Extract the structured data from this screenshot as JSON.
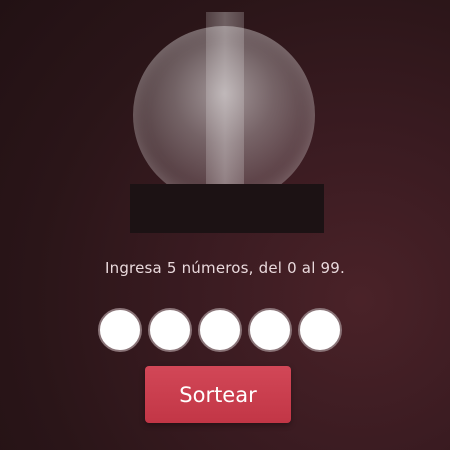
{
  "instruction": "Ingresa 5 números, del 0 al 99.",
  "number_inputs": [
    {
      "value": ""
    },
    {
      "value": ""
    },
    {
      "value": ""
    },
    {
      "value": ""
    },
    {
      "value": ""
    }
  ],
  "draw_button_label": "Sortear",
  "colors": {
    "background": "#2a1518",
    "accent": "#c8404f",
    "text": "#e9d9dc",
    "globe_base": "#1c1214"
  }
}
